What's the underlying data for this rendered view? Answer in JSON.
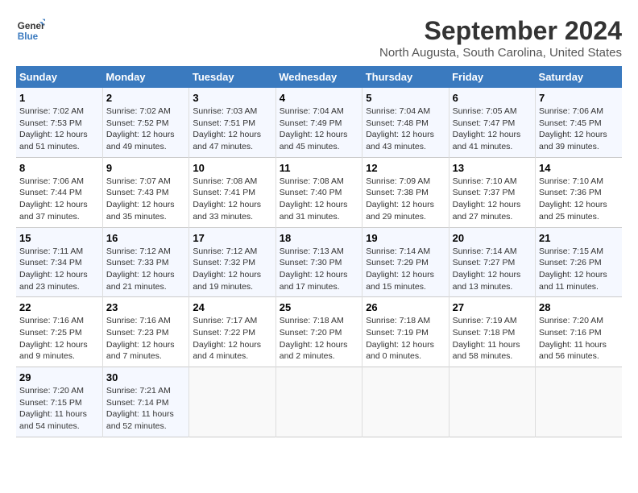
{
  "header": {
    "logo_line1": "General",
    "logo_line2": "Blue",
    "title": "September 2024",
    "subtitle": "North Augusta, South Carolina, United States"
  },
  "calendar": {
    "days_of_week": [
      "Sunday",
      "Monday",
      "Tuesday",
      "Wednesday",
      "Thursday",
      "Friday",
      "Saturday"
    ],
    "weeks": [
      [
        null,
        {
          "day": "2",
          "sunrise": "Sunrise: 7:02 AM",
          "sunset": "Sunset: 7:52 PM",
          "daylight": "Daylight: 12 hours and 49 minutes."
        },
        {
          "day": "3",
          "sunrise": "Sunrise: 7:03 AM",
          "sunset": "Sunset: 7:51 PM",
          "daylight": "Daylight: 12 hours and 47 minutes."
        },
        {
          "day": "4",
          "sunrise": "Sunrise: 7:04 AM",
          "sunset": "Sunset: 7:49 PM",
          "daylight": "Daylight: 12 hours and 45 minutes."
        },
        {
          "day": "5",
          "sunrise": "Sunrise: 7:04 AM",
          "sunset": "Sunset: 7:48 PM",
          "daylight": "Daylight: 12 hours and 43 minutes."
        },
        {
          "day": "6",
          "sunrise": "Sunrise: 7:05 AM",
          "sunset": "Sunset: 7:47 PM",
          "daylight": "Daylight: 12 hours and 41 minutes."
        },
        {
          "day": "7",
          "sunrise": "Sunrise: 7:06 AM",
          "sunset": "Sunset: 7:45 PM",
          "daylight": "Daylight: 12 hours and 39 minutes."
        }
      ],
      [
        {
          "day": "1",
          "sunrise": "Sunrise: 7:02 AM",
          "sunset": "Sunset: 7:53 PM",
          "daylight": "Daylight: 12 hours and 51 minutes."
        },
        null,
        null,
        null,
        null,
        null,
        null
      ],
      [
        {
          "day": "8",
          "sunrise": "Sunrise: 7:06 AM",
          "sunset": "Sunset: 7:44 PM",
          "daylight": "Daylight: 12 hours and 37 minutes."
        },
        {
          "day": "9",
          "sunrise": "Sunrise: 7:07 AM",
          "sunset": "Sunset: 7:43 PM",
          "daylight": "Daylight: 12 hours and 35 minutes."
        },
        {
          "day": "10",
          "sunrise": "Sunrise: 7:08 AM",
          "sunset": "Sunset: 7:41 PM",
          "daylight": "Daylight: 12 hours and 33 minutes."
        },
        {
          "day": "11",
          "sunrise": "Sunrise: 7:08 AM",
          "sunset": "Sunset: 7:40 PM",
          "daylight": "Daylight: 12 hours and 31 minutes."
        },
        {
          "day": "12",
          "sunrise": "Sunrise: 7:09 AM",
          "sunset": "Sunset: 7:38 PM",
          "daylight": "Daylight: 12 hours and 29 minutes."
        },
        {
          "day": "13",
          "sunrise": "Sunrise: 7:10 AM",
          "sunset": "Sunset: 7:37 PM",
          "daylight": "Daylight: 12 hours and 27 minutes."
        },
        {
          "day": "14",
          "sunrise": "Sunrise: 7:10 AM",
          "sunset": "Sunset: 7:36 PM",
          "daylight": "Daylight: 12 hours and 25 minutes."
        }
      ],
      [
        {
          "day": "15",
          "sunrise": "Sunrise: 7:11 AM",
          "sunset": "Sunset: 7:34 PM",
          "daylight": "Daylight: 12 hours and 23 minutes."
        },
        {
          "day": "16",
          "sunrise": "Sunrise: 7:12 AM",
          "sunset": "Sunset: 7:33 PM",
          "daylight": "Daylight: 12 hours and 21 minutes."
        },
        {
          "day": "17",
          "sunrise": "Sunrise: 7:12 AM",
          "sunset": "Sunset: 7:32 PM",
          "daylight": "Daylight: 12 hours and 19 minutes."
        },
        {
          "day": "18",
          "sunrise": "Sunrise: 7:13 AM",
          "sunset": "Sunset: 7:30 PM",
          "daylight": "Daylight: 12 hours and 17 minutes."
        },
        {
          "day": "19",
          "sunrise": "Sunrise: 7:14 AM",
          "sunset": "Sunset: 7:29 PM",
          "daylight": "Daylight: 12 hours and 15 minutes."
        },
        {
          "day": "20",
          "sunrise": "Sunrise: 7:14 AM",
          "sunset": "Sunset: 7:27 PM",
          "daylight": "Daylight: 12 hours and 13 minutes."
        },
        {
          "day": "21",
          "sunrise": "Sunrise: 7:15 AM",
          "sunset": "Sunset: 7:26 PM",
          "daylight": "Daylight: 12 hours and 11 minutes."
        }
      ],
      [
        {
          "day": "22",
          "sunrise": "Sunrise: 7:16 AM",
          "sunset": "Sunset: 7:25 PM",
          "daylight": "Daylight: 12 hours and 9 minutes."
        },
        {
          "day": "23",
          "sunrise": "Sunrise: 7:16 AM",
          "sunset": "Sunset: 7:23 PM",
          "daylight": "Daylight: 12 hours and 7 minutes."
        },
        {
          "day": "24",
          "sunrise": "Sunrise: 7:17 AM",
          "sunset": "Sunset: 7:22 PM",
          "daylight": "Daylight: 12 hours and 4 minutes."
        },
        {
          "day": "25",
          "sunrise": "Sunrise: 7:18 AM",
          "sunset": "Sunset: 7:20 PM",
          "daylight": "Daylight: 12 hours and 2 minutes."
        },
        {
          "day": "26",
          "sunrise": "Sunrise: 7:18 AM",
          "sunset": "Sunset: 7:19 PM",
          "daylight": "Daylight: 12 hours and 0 minutes."
        },
        {
          "day": "27",
          "sunrise": "Sunrise: 7:19 AM",
          "sunset": "Sunset: 7:18 PM",
          "daylight": "Daylight: 11 hours and 58 minutes."
        },
        {
          "day": "28",
          "sunrise": "Sunrise: 7:20 AM",
          "sunset": "Sunset: 7:16 PM",
          "daylight": "Daylight: 11 hours and 56 minutes."
        }
      ],
      [
        {
          "day": "29",
          "sunrise": "Sunrise: 7:20 AM",
          "sunset": "Sunset: 7:15 PM",
          "daylight": "Daylight: 11 hours and 54 minutes."
        },
        {
          "day": "30",
          "sunrise": "Sunrise: 7:21 AM",
          "sunset": "Sunset: 7:14 PM",
          "daylight": "Daylight: 11 hours and 52 minutes."
        },
        null,
        null,
        null,
        null,
        null
      ]
    ]
  }
}
